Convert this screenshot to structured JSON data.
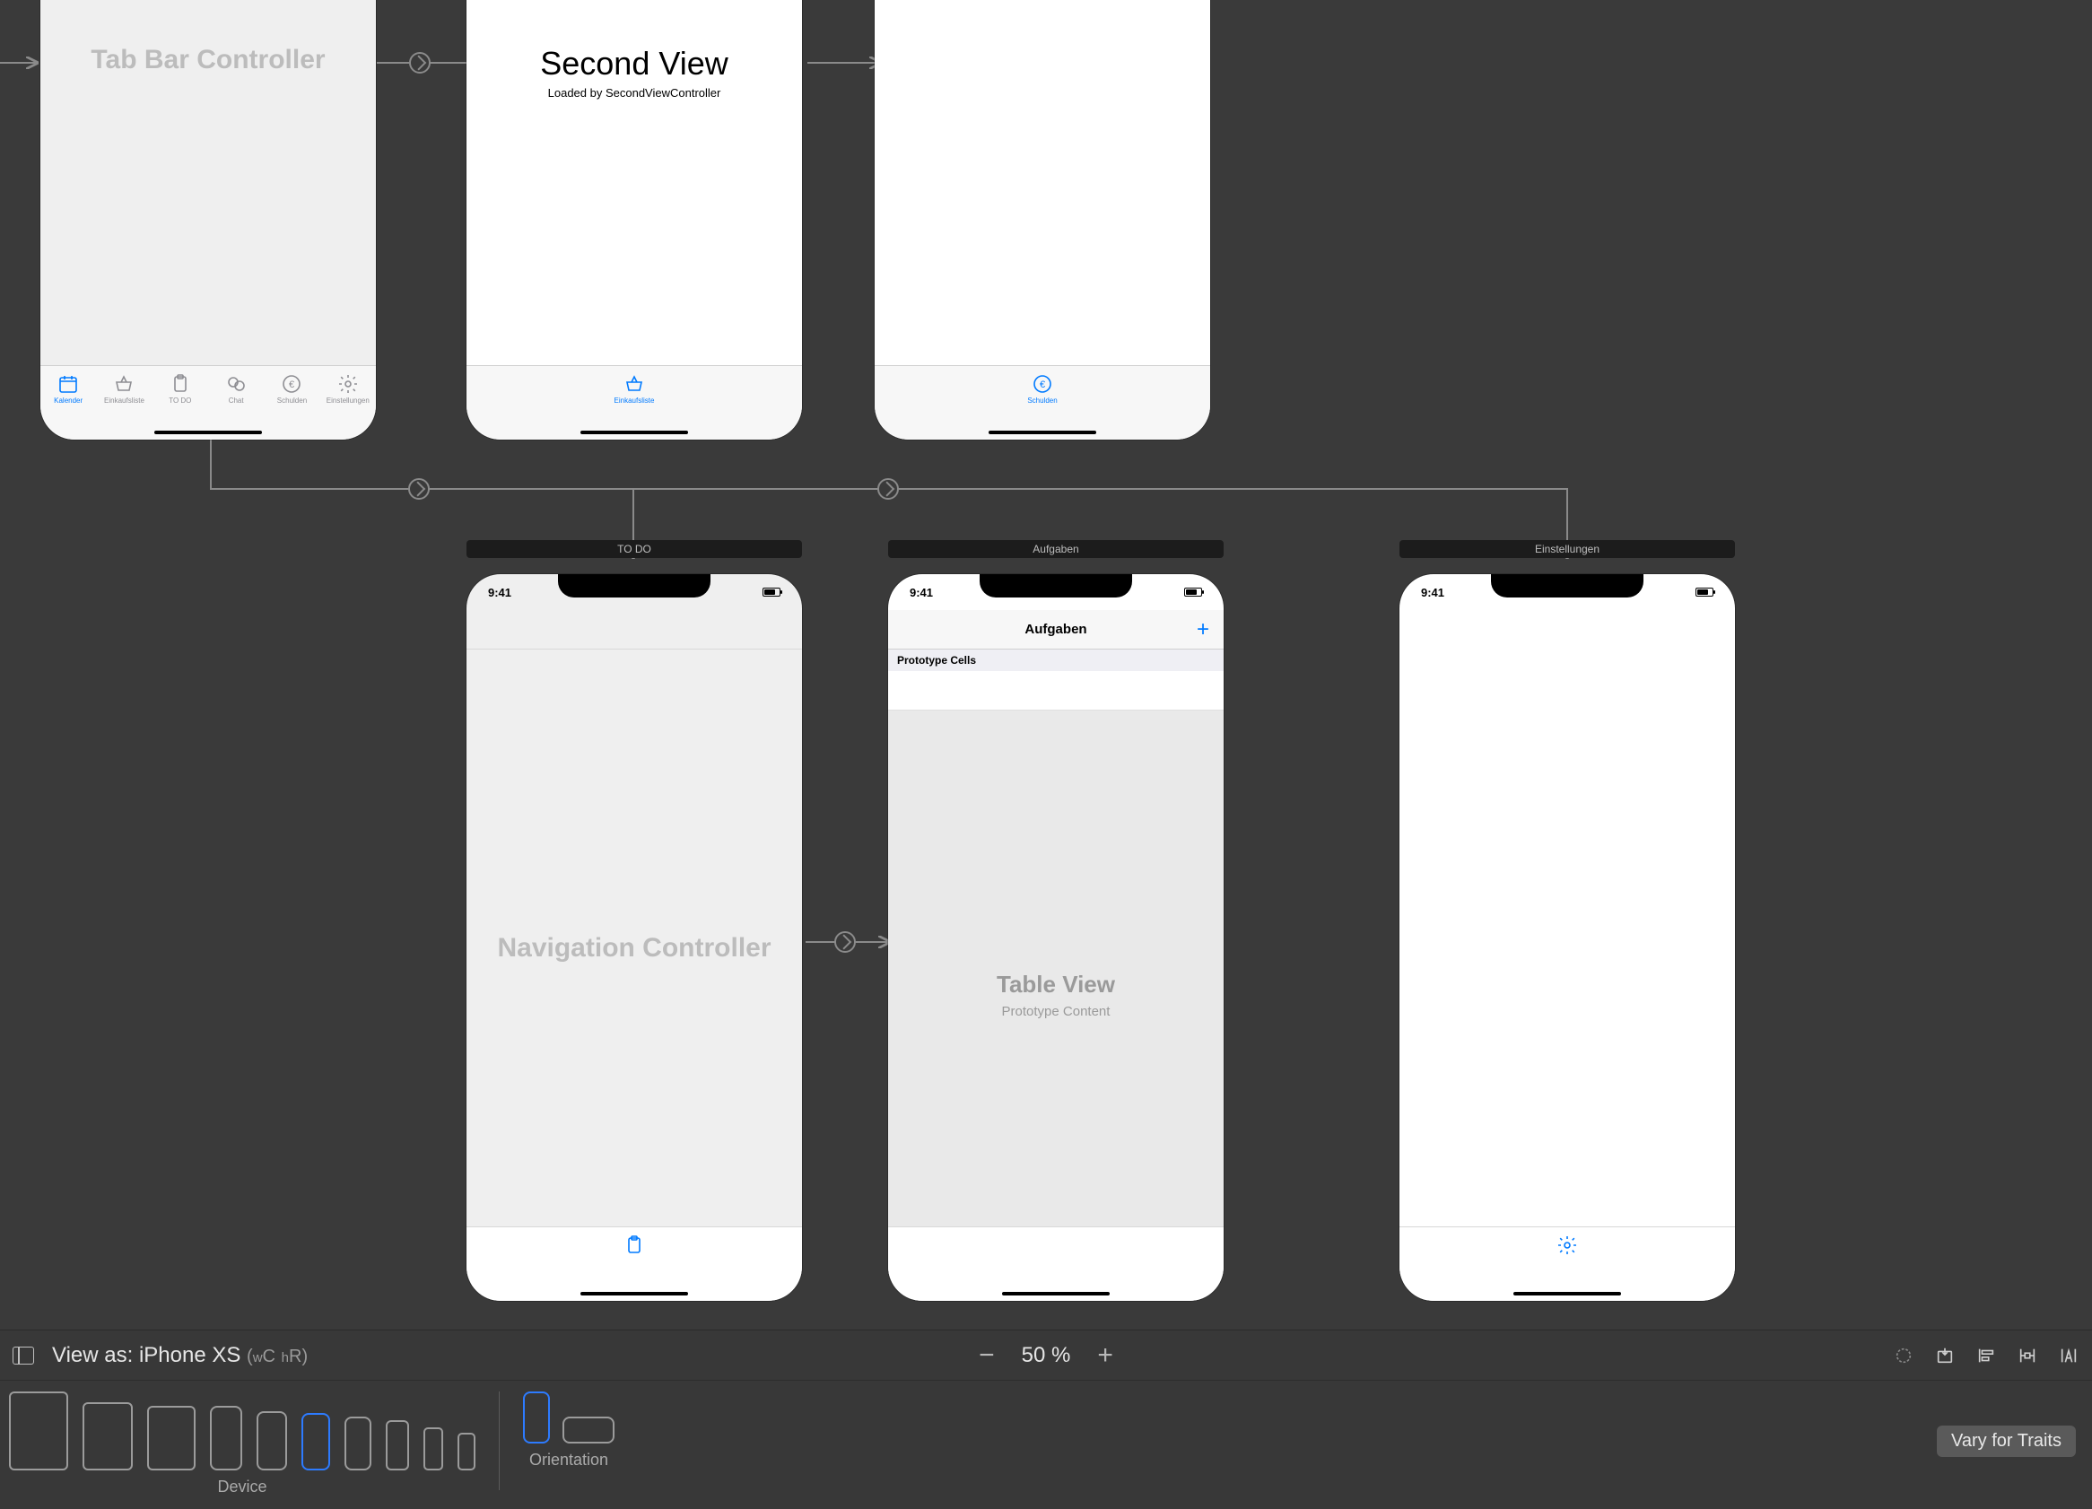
{
  "scenes": {
    "tabBarController": {
      "title": "Tab Bar Controller"
    },
    "secondView": {
      "title": "Second View",
      "subtitle": "Loaded by SecondViewController"
    },
    "navController": {
      "title": "Navigation Controller",
      "label": "TO DO"
    },
    "aufgaben": {
      "label": "Aufgaben",
      "navTitle": "Aufgaben",
      "protoHeader": "Prototype Cells",
      "tableTitle": "Table View",
      "tableSub": "Prototype Content"
    },
    "einstellungen": {
      "label": "Einstellungen"
    }
  },
  "tabs": [
    {
      "label": "Kalender",
      "active": true
    },
    {
      "label": "Einkaufsliste",
      "active": false
    },
    {
      "label": "TO DO",
      "active": false
    },
    {
      "label": "Chat",
      "active": false
    },
    {
      "label": "Schulden",
      "active": false
    },
    {
      "label": "Einstellungen",
      "active": false
    }
  ],
  "singleTabEinkauf": "Einkaufsliste",
  "singleTabSchulden": "Schulden",
  "statusTime": "9:41",
  "toolbar": {
    "viewAs": "View as: iPhone XS",
    "sizeClass": "(wC hR)",
    "sizeClassW": "C",
    "sizeClassH": "R",
    "zoom": "50 %",
    "deviceLabel": "Device",
    "orientationLabel": "Orientation",
    "varyForTraits": "Vary for Traits"
  }
}
